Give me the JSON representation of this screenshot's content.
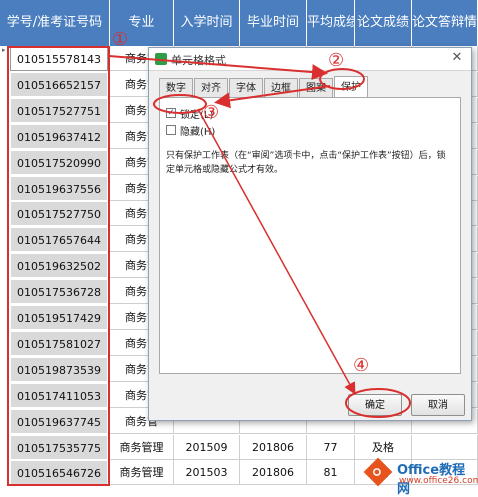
{
  "columns": [
    "学号/准考证号码",
    "专业",
    "入学时间",
    "毕业时间",
    "平均成绩",
    "论文成绩",
    "论文答辩情况"
  ],
  "row_marker": "▸",
  "rows": [
    {
      "id": "010515578143",
      "major": "商务管",
      "enroll": "",
      "grad": "",
      "avg": "",
      "thesis": ""
    },
    {
      "id": "010516652157",
      "major": "商务管",
      "enroll": "",
      "grad": "",
      "avg": "",
      "thesis": ""
    },
    {
      "id": "010517527751",
      "major": "商务管",
      "enroll": "",
      "grad": "",
      "avg": "",
      "thesis": ""
    },
    {
      "id": "010519637412",
      "major": "商务管",
      "enroll": "",
      "grad": "",
      "avg": "",
      "thesis": ""
    },
    {
      "id": "010517520990",
      "major": "商务管",
      "enroll": "",
      "grad": "",
      "avg": "",
      "thesis": ""
    },
    {
      "id": "010519637556",
      "major": "商务管",
      "enroll": "",
      "grad": "",
      "avg": "",
      "thesis": ""
    },
    {
      "id": "010517527750",
      "major": "商务管",
      "enroll": "",
      "grad": "",
      "avg": "",
      "thesis": ""
    },
    {
      "id": "010517657644",
      "major": "商务管",
      "enroll": "",
      "grad": "",
      "avg": "",
      "thesis": ""
    },
    {
      "id": "010519632502",
      "major": "商务管",
      "enroll": "",
      "grad": "",
      "avg": "",
      "thesis": ""
    },
    {
      "id": "010517536728",
      "major": "商务管",
      "enroll": "",
      "grad": "",
      "avg": "",
      "thesis": ""
    },
    {
      "id": "010519517429",
      "major": "商务管",
      "enroll": "",
      "grad": "",
      "avg": "",
      "thesis": ""
    },
    {
      "id": "010517581027",
      "major": "商务管",
      "enroll": "",
      "grad": "",
      "avg": "",
      "thesis": ""
    },
    {
      "id": "010519873539",
      "major": "商务管",
      "enroll": "",
      "grad": "",
      "avg": "",
      "thesis": ""
    },
    {
      "id": "010517411053",
      "major": "商务管",
      "enroll": "",
      "grad": "",
      "avg": "",
      "thesis": ""
    },
    {
      "id": "010519637745",
      "major": "商务管",
      "enroll": "",
      "grad": "",
      "avg": "",
      "thesis": ""
    },
    {
      "id": "010517535775",
      "major": "商务管理",
      "enroll": "201509",
      "grad": "201806",
      "avg": "77",
      "thesis": "及格"
    },
    {
      "id": "010516546726",
      "major": "商务管理",
      "enroll": "201503",
      "grad": "201806",
      "avg": "81",
      "thesis": "良"
    }
  ],
  "dialog": {
    "title": "单元格格式",
    "close": "✕",
    "tabs": [
      "数字",
      "对齐",
      "字体",
      "边框",
      "图案",
      "保护"
    ],
    "active_tab": "保护",
    "lock_label": "锁定(L)",
    "lock_checked": true,
    "hide_label": "隐藏(H)",
    "hide_checked": false,
    "note": "只有保护工作表（在“审阅”选项卡中，点击“保护工作表”按钮）后，锁定单元格或隐藏公式才有效。",
    "ok_label": "确定",
    "cancel_label": "取消"
  },
  "annotations": {
    "n1": "①",
    "n2": "②",
    "n3": "③",
    "n4": "④"
  },
  "watermark": {
    "brand": "Office教程网",
    "url": "www.office26.com"
  },
  "colors": {
    "header": "#4a7ebf",
    "annotation": "#d9302f",
    "id_cell": "#d9d9d9"
  }
}
